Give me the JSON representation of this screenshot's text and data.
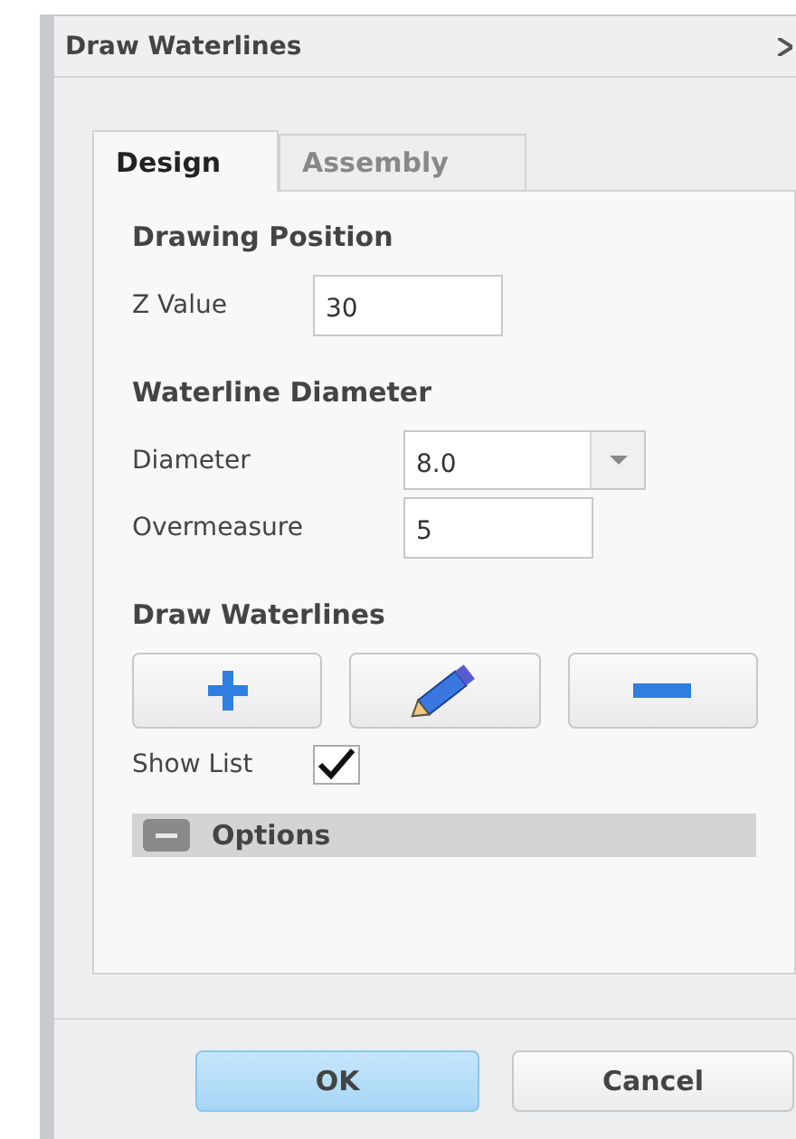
{
  "window": {
    "title": "Draw Waterlines"
  },
  "tabs": [
    {
      "label": "Design",
      "selected": true
    },
    {
      "label": "Assembly",
      "selected": false
    }
  ],
  "drawing_position": {
    "heading": "Drawing Position",
    "z_label": "Z Value",
    "z_value": "30"
  },
  "waterline_diameter": {
    "heading": "Waterline Diameter",
    "diameter_label": "Diameter",
    "diameter_value": "8.0",
    "overmeasure_label": "Overmeasure",
    "overmeasure_value": "5"
  },
  "draw_waterlines": {
    "heading": "Draw Waterlines",
    "tools": [
      {
        "kind": "add"
      },
      {
        "kind": "edit"
      },
      {
        "kind": "remove"
      }
    ],
    "show_list": {
      "label": "Show List",
      "checked": true
    }
  },
  "options": {
    "label": "Options",
    "expanded": true
  },
  "buttons": [
    {
      "label": "OK",
      "default": true
    },
    {
      "label": "Cancel",
      "default": false
    }
  ]
}
